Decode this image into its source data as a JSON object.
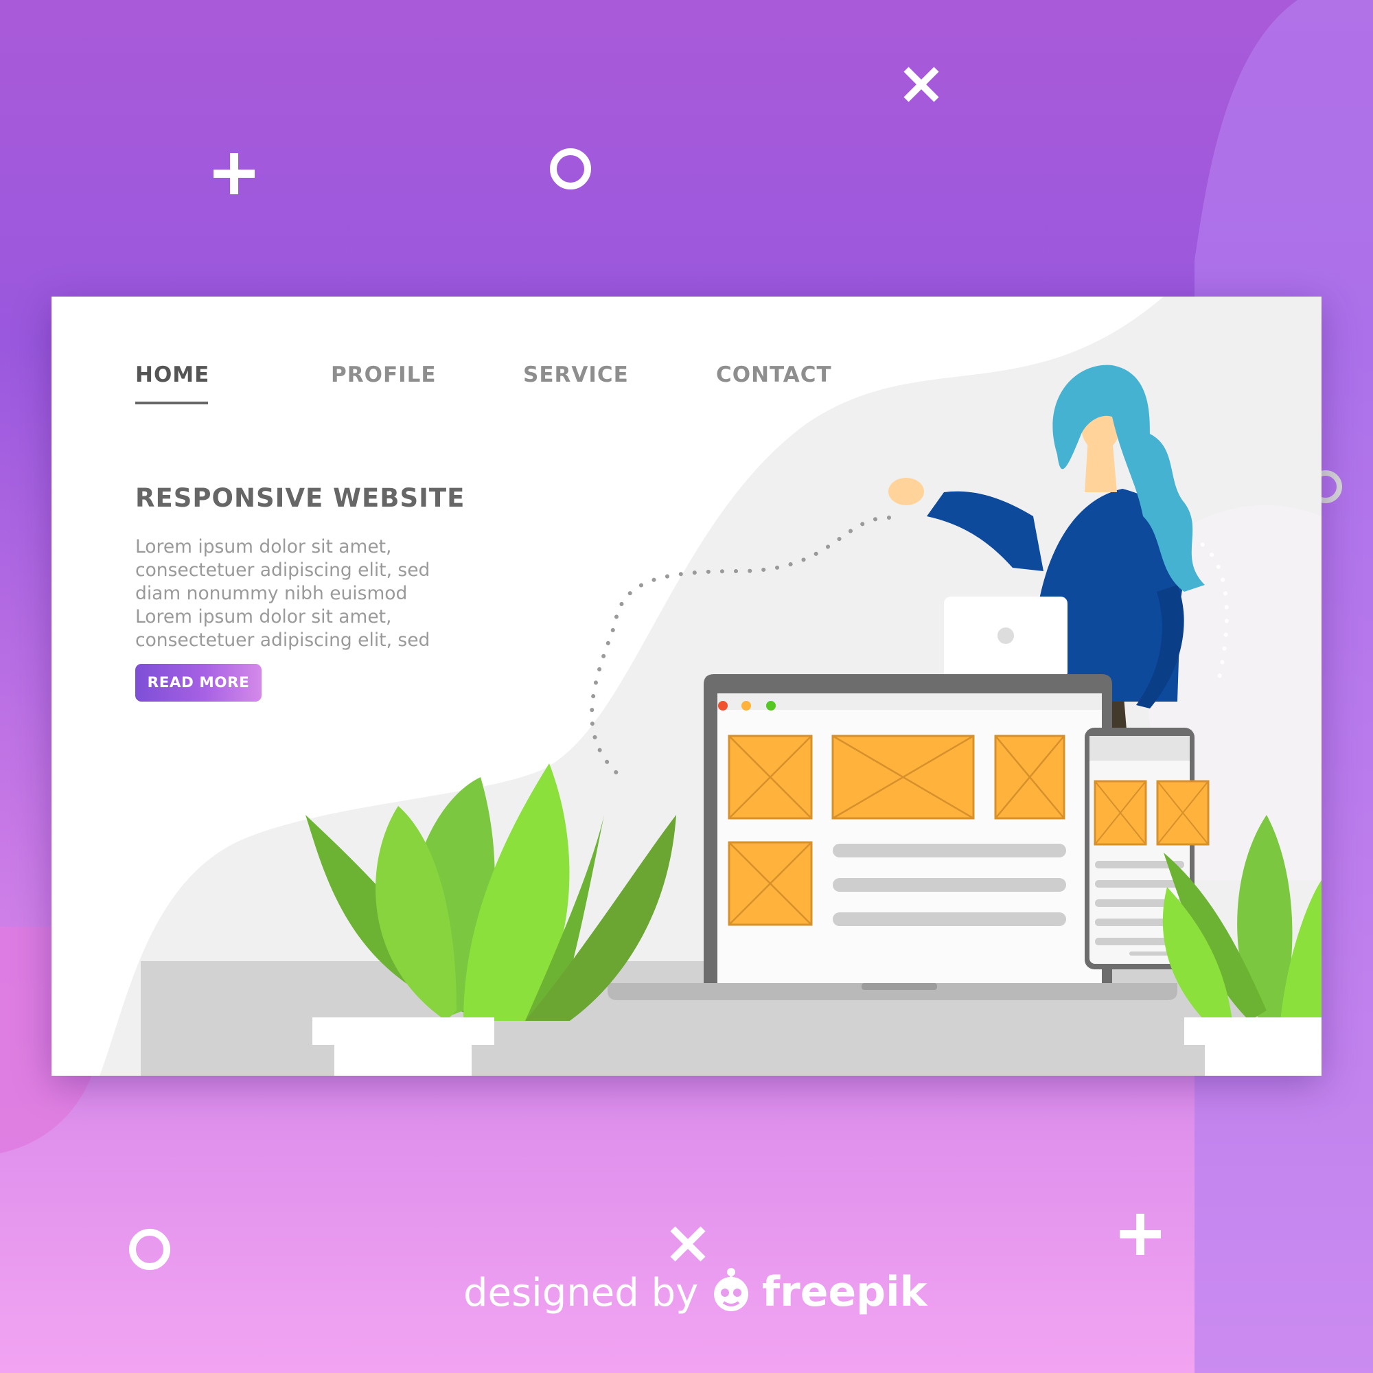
{
  "nav": {
    "items": [
      {
        "label": "HOME",
        "active": true
      },
      {
        "label": "PROFILE",
        "active": false
      },
      {
        "label": "SERVICE",
        "active": false
      },
      {
        "label": "CONTACT",
        "active": false
      }
    ]
  },
  "hero": {
    "title": "RESPONSIVE WEBSITE",
    "body": "Lorem ipsum dolor sit amet,\nconsectetuer adipiscing elit, sed\ndiam nonummy nibh euismod\nLorem ipsum dolor sit amet,\nconsectetuer adipiscing elit, sed",
    "button_label": "READ MORE"
  },
  "credit": {
    "text": "designed by",
    "brand": "freepik"
  },
  "colors": {
    "accent_purple": "#8b55dc",
    "button_gradient_end": "#d48ae9",
    "placeholder_orange": "#ffb23c",
    "leaf_green": "#8be03c",
    "shirt_blue": "#0d4a9c",
    "hair_teal": "#45b2d2"
  },
  "icons": [
    "plus-icon",
    "circle-icon",
    "close-icon",
    "window-dot-icon",
    "freepik-logo-icon"
  ]
}
